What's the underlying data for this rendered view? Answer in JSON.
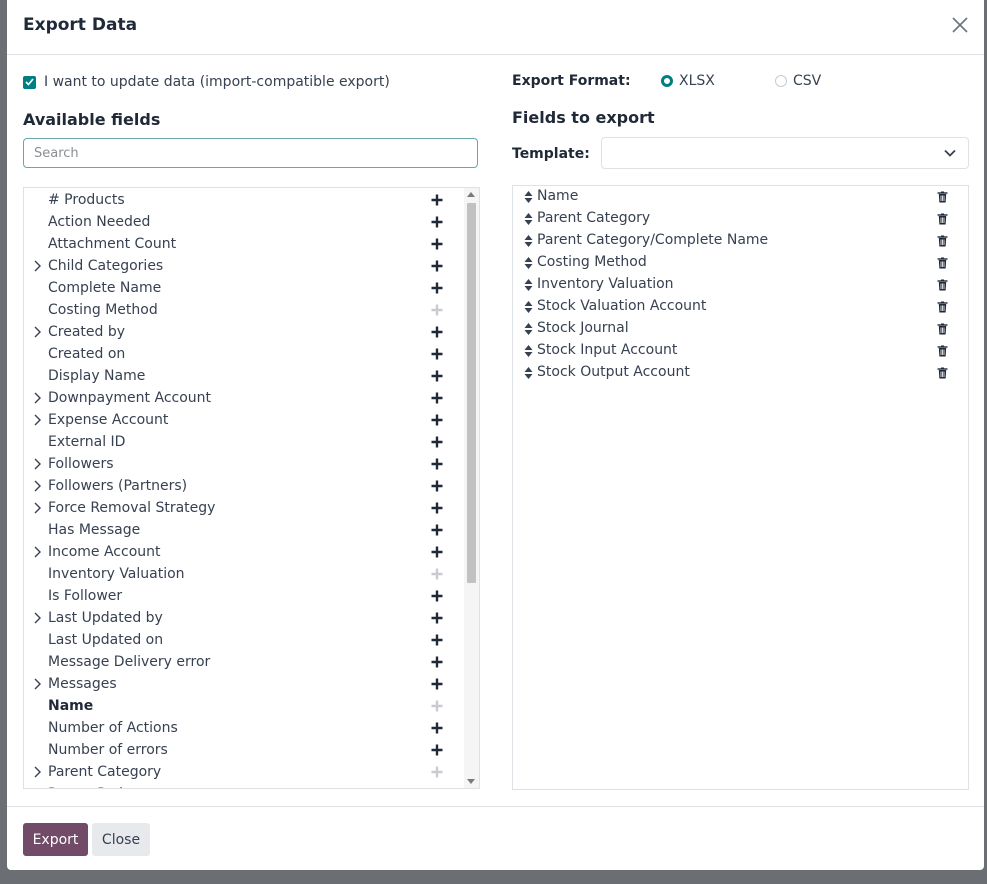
{
  "dialog": {
    "title": "Export Data"
  },
  "options": {
    "import_compatible_label": "I want to update data (import-compatible export)",
    "import_compatible_checked": true
  },
  "available": {
    "heading": "Available fields",
    "search_placeholder": "Search",
    "fields": [
      {
        "label": "# Products",
        "expandable": false,
        "bold": false,
        "added": false
      },
      {
        "label": "Action Needed",
        "expandable": false,
        "bold": false,
        "added": false
      },
      {
        "label": "Attachment Count",
        "expandable": false,
        "bold": false,
        "added": false
      },
      {
        "label": "Child Categories",
        "expandable": true,
        "bold": false,
        "added": false
      },
      {
        "label": "Complete Name",
        "expandable": false,
        "bold": false,
        "added": false
      },
      {
        "label": "Costing Method",
        "expandable": false,
        "bold": false,
        "added": true
      },
      {
        "label": "Created by",
        "expandable": true,
        "bold": false,
        "added": false
      },
      {
        "label": "Created on",
        "expandable": false,
        "bold": false,
        "added": false
      },
      {
        "label": "Display Name",
        "expandable": false,
        "bold": false,
        "added": false
      },
      {
        "label": "Downpayment Account",
        "expandable": true,
        "bold": false,
        "added": false
      },
      {
        "label": "Expense Account",
        "expandable": true,
        "bold": false,
        "added": false
      },
      {
        "label": "External ID",
        "expandable": false,
        "bold": false,
        "added": false
      },
      {
        "label": "Followers",
        "expandable": true,
        "bold": false,
        "added": false
      },
      {
        "label": "Followers (Partners)",
        "expandable": true,
        "bold": false,
        "added": false
      },
      {
        "label": "Force Removal Strategy",
        "expandable": true,
        "bold": false,
        "added": false
      },
      {
        "label": "Has Message",
        "expandable": false,
        "bold": false,
        "added": false
      },
      {
        "label": "Income Account",
        "expandable": true,
        "bold": false,
        "added": false
      },
      {
        "label": "Inventory Valuation",
        "expandable": false,
        "bold": false,
        "added": true
      },
      {
        "label": "Is Follower",
        "expandable": false,
        "bold": false,
        "added": false
      },
      {
        "label": "Last Updated by",
        "expandable": true,
        "bold": false,
        "added": false
      },
      {
        "label": "Last Updated on",
        "expandable": false,
        "bold": false,
        "added": false
      },
      {
        "label": "Message Delivery error",
        "expandable": false,
        "bold": false,
        "added": false
      },
      {
        "label": "Messages",
        "expandable": true,
        "bold": false,
        "added": false
      },
      {
        "label": "Name",
        "expandable": false,
        "bold": true,
        "added": true
      },
      {
        "label": "Number of Actions",
        "expandable": false,
        "bold": false,
        "added": false
      },
      {
        "label": "Number of errors",
        "expandable": false,
        "bold": false,
        "added": false
      },
      {
        "label": "Parent Category",
        "expandable": true,
        "bold": false,
        "added": true
      },
      {
        "label": "Parent Path",
        "expandable": false,
        "bold": false,
        "added": false
      }
    ]
  },
  "format": {
    "label": "Export Format:",
    "options": [
      {
        "label": "XLSX",
        "selected": true
      },
      {
        "label": "CSV",
        "selected": false
      }
    ]
  },
  "export": {
    "heading": "Fields to export",
    "template_label": "Template:",
    "template_value": "",
    "fields": [
      "Name",
      "Parent Category",
      "Parent Category/Complete Name",
      "Costing Method",
      "Inventory Valuation",
      "Stock Valuation Account",
      "Stock Journal",
      "Stock Input Account",
      "Stock Output Account"
    ]
  },
  "footer": {
    "export_label": "Export",
    "close_label": "Close"
  },
  "colors": {
    "primary": "#714b67",
    "accent": "#017e84"
  }
}
